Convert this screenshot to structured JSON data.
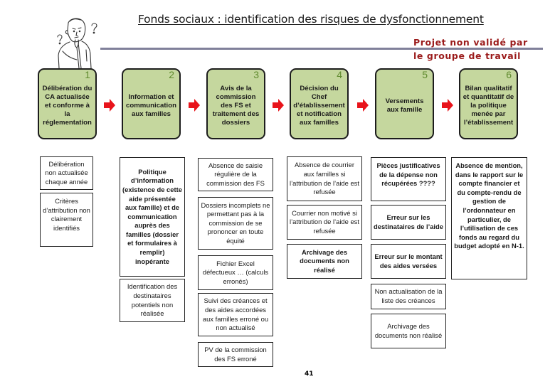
{
  "header": {
    "title": "Fonds sociaux : identification des risques de dysfonctionnement",
    "stamp_line1": "Projet non validé par",
    "stamp_line2": "le groupe de travail",
    "colors": {
      "stamp": "#9b1b1b",
      "rule": "#80809a",
      "step_fill": "#c5d79e",
      "arrow": "#e8141b",
      "step_number": "#5f8a2e"
    }
  },
  "illustration": {
    "icon": "thinking-person-icon",
    "description": "Pensive cartoon man with question marks"
  },
  "steps": [
    {
      "number": "1",
      "label": "Délibération du CA actualisée et conforme à la réglementation"
    },
    {
      "number": "2",
      "label": "Information et communication aux familles"
    },
    {
      "number": "3",
      "label": "Avis de la commission des FS et traitement des dossiers"
    },
    {
      "number": "4",
      "label": "Décision du Chef d’établissement et notification aux familles"
    },
    {
      "number": "5",
      "label": "Versements aux famille"
    },
    {
      "number": "6",
      "label": "Bilan qualitatif et quantitatif de la politique menée par l’établissement"
    }
  ],
  "arrows": {
    "icon": "red-right-arrow-icon",
    "count": 5
  },
  "risks": {
    "col1": [
      "Délibération non actualisée chaque année",
      "Critères d’attribution non clairement identifiés"
    ],
    "col2": [
      "Politique d’information (existence de cette aide présentée aux famille) et de communication auprès des familles (dossier et formulaires à remplir) inopérante",
      "Identification des destinataires potentiels non réalisée"
    ],
    "col3": [
      "Absence de saisie régulière de la commission des FS",
      "Dossiers incomplets ne permettant pas à la commission de se prononcer en toute équité",
      "Fichier Excel défectueux … (calculs erronés)",
      "Suivi des créances et des aides accordées aux familles erroné ou non actualisé",
      "PV de la commission des FS erroné"
    ],
    "col4": [
      "Absence de courrier aux familles si l’attribution de l’aide est refusée",
      "Courrier non motivé si l’attribution de l’aide est refusée",
      "Archivage des documents non réalisé"
    ],
    "col5": [
      "Pièces justificatives de la dépense non récupérées ????",
      "Erreur sur les destinataires de l’aide",
      "Erreur sur le montant des aides versées",
      "Non actualisation de la liste des créances",
      "Archivage des documents non réalisé"
    ],
    "col6": [
      "Absence de mention, dans le rapport sur le compte financier et du compte-rendu de gestion de l’ordonnateur en particulier, de l’utilisation de ces fonds au regard du budget adopté en N-1."
    ]
  },
  "footer": {
    "page_number": "41"
  }
}
